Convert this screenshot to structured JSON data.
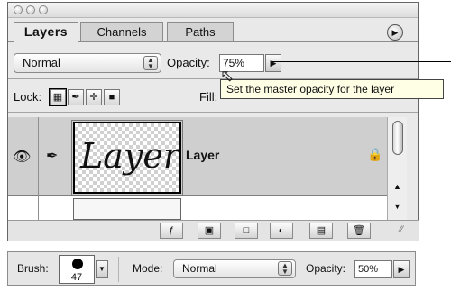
{
  "palette": {
    "tabs": [
      "Layers",
      "Channels",
      "Paths"
    ],
    "menu_icon": "palette-menu-arrow-icon",
    "blend_mode": "Normal",
    "opacity_label": "Opacity:",
    "opacity_value": "75%",
    "lock_label": "Lock:",
    "lock_icons": [
      "lock-transparency-icon",
      "lock-image-icon",
      "lock-position-icon",
      "lock-all-icon"
    ],
    "fill_label": "Fill:",
    "tooltip": "Set the master opacity for the layer",
    "layer": {
      "name": "Layer",
      "thumb_text": "Layer",
      "visibility_icon": "eye-icon",
      "brush_icon": "paintbrush-icon",
      "lock_icon": "lock-icon"
    },
    "bottom_buttons": [
      "add-layer-style-icon",
      "add-mask-icon",
      "new-group-icon",
      "new-adjustment-layer-icon",
      "new-layer-icon",
      "trash-icon"
    ]
  },
  "options_bar": {
    "brush_label": "Brush:",
    "brush_size": "47",
    "mode_label": "Mode:",
    "mode_value": "Normal",
    "opacity_label": "Opacity:",
    "opacity_value": "50%"
  },
  "colors": {
    "tooltip_bg": "#ffffe6",
    "panel_bg": "#e9e9e9",
    "selected_row": "#cfcfcf"
  }
}
